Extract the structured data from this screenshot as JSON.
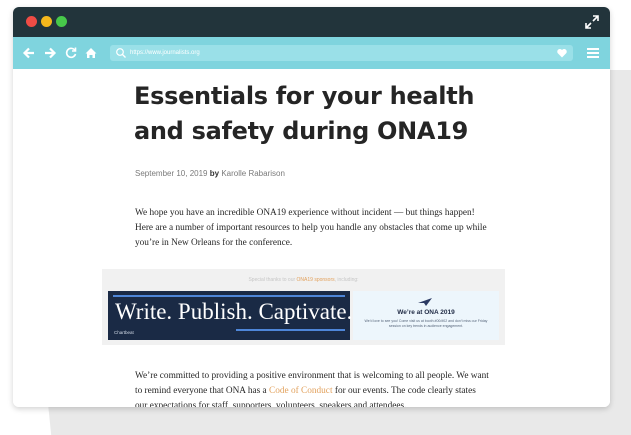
{
  "browser": {
    "url": "https://www.journalists.org",
    "nav_icons": [
      "back-arrow-icon",
      "forward-arrow-icon",
      "reload-icon",
      "home-icon"
    ]
  },
  "article": {
    "title": "Essentials for your health and safety during ONA19",
    "date": "September 10, 2019",
    "by_label": "by",
    "author": "Karolle Rabarison",
    "intro": "We hope you have an incredible ONA19 experience without incident — but things happen! Here are a number of important resources to help you handle any obstacles that come up while you’re in New Orleans for the conference.",
    "p2_before": "We’re committed to providing a positive environment that is welcoming to all people. We want to remind everyone that ONA has a ",
    "p2_link": "Code of Conduct",
    "p2_after": " for our events. The code clearly states our expectations for staff, supporters, volunteers, speakers and attendees."
  },
  "sponsors": {
    "note_before": "Special thanks to our ",
    "note_link": "ONA19 sponsors",
    "note_after": ", including:",
    "ad_left": {
      "headline": "Write. Publish. Captivate.",
      "brand": "Chartbeat"
    },
    "ad_right": {
      "title": "We’re at ONA 2019",
      "subtitle": "We’d love to see you! Come visit us at booth #00/#02 and don’t miss our Friday session on key trends in audience engagement."
    }
  },
  "colors": {
    "titlebar": "#22343b",
    "toolbar": "#7fd4de",
    "link": "#e2a15c",
    "ad_dark": "#1a2a45"
  }
}
